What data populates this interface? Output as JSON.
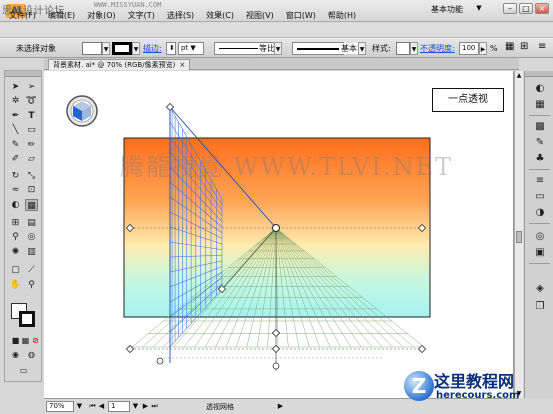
{
  "top": {
    "watermark": "思缘设计论坛",
    "site": "WWW.MISSYUAN.COM",
    "app_icon": "Ai",
    "menus": [
      "文件(F)",
      "编辑(E)",
      "对象(O)",
      "文字(T)",
      "选择(S)",
      "效果(C)",
      "视图(V)",
      "窗口(W)",
      "帮助(H)"
    ],
    "workspace": "基本功能",
    "window_buttons": [
      "–",
      "□",
      "×"
    ]
  },
  "control_bar": {
    "selection": "未选择对象",
    "stroke_label": "描边:",
    "stroke_unit": "pt",
    "profile_label": "等比",
    "brush_label": "基本",
    "style_label": "样式:",
    "opacity_label": "不透明度:",
    "opacity_value": "100",
    "opacity_unit": "%"
  },
  "document_tab": {
    "title": "背景素材. ai* @ 70% (RGB/像素预览)",
    "close": "×"
  },
  "canvas": {
    "one_point_label": "一点透视",
    "watermark": "腾龍視覺 WWW.TLVI.NET",
    "gradient_top": "#ff7a2a",
    "gradient_mid": "#ffe7a6",
    "gradient_bottom": "#aef5ee",
    "grid_left_color": "#2d6fe0",
    "grid_floor_color": "#8db86e"
  },
  "status": {
    "zoom": "70%",
    "page": "1",
    "tool_name": "透视网格"
  },
  "brand_watermark": {
    "title": "这里教程网",
    "url": "herecours.com",
    "icon": "Z"
  },
  "tools": [
    "selection-arrow-icon",
    "direct-selection-icon",
    "magic-wand-icon",
    "lasso-icon",
    "pen-icon",
    "type-icon",
    "line-icon",
    "rectangle-icon",
    "paintbrush-icon",
    "pencil-icon",
    "blob-brush-icon",
    "eraser-icon",
    "rotate-icon",
    "scale-icon",
    "warp-icon",
    "free-transform-icon",
    "shape-builder-icon",
    "perspective-grid-icon",
    "mesh-icon",
    "gradient-icon",
    "eyedropper-icon",
    "blend-icon",
    "symbol-sprayer-icon",
    "column-graph-icon",
    "artboard-icon",
    "slice-icon",
    "hand-icon",
    "zoom-icon"
  ],
  "panels": [
    "color-panel-icon",
    "color-guide-icon",
    "swatches-icon",
    "brushes-icon",
    "symbols-icon",
    "stroke-icon",
    "gradient-panel-icon",
    "transparency-icon",
    "appearance-icon",
    "graphic-styles-icon",
    "layers-icon",
    "artboards-icon"
  ]
}
